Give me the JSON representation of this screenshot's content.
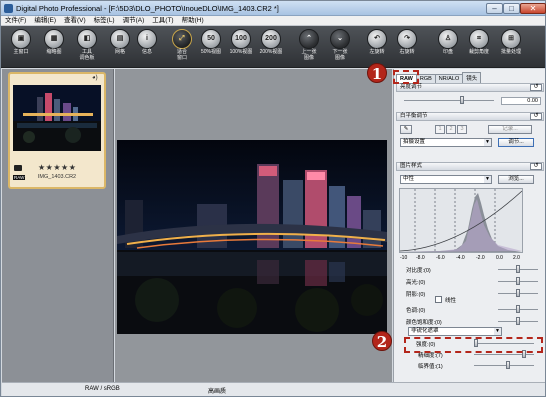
{
  "window": {
    "title": "Digital Photo Professional - [F:\\5D3\\DLO_PHOTO\\InoueDLO\\IMG_1403.CR2 *]"
  },
  "menu": [
    "文件(F)",
    "编辑(E)",
    "查看(V)",
    "标签(L)",
    "调节(A)",
    "工具(T)",
    "帮助(H)"
  ],
  "toolbar": [
    {
      "label": "主窗口",
      "icon": "main-window-icon"
    },
    {
      "label": "缩略图",
      "icon": "thumbnail-icon"
    },
    {
      "label": "工具\n调色板",
      "icon": "tool-palette-icon"
    },
    {
      "label": "网格",
      "icon": "grid-icon"
    },
    {
      "label": "信息",
      "icon": "info-icon"
    },
    {
      "label": "适合\n窗口",
      "icon": "fit-window-icon"
    },
    {
      "label": "50%视图",
      "icon": "zoom-50-icon",
      "text": "50"
    },
    {
      "label": "100%视图",
      "icon": "zoom-100-icon",
      "text": "100"
    },
    {
      "label": "200%视图",
      "icon": "zoom-200-icon",
      "text": "200"
    },
    {
      "label": "上一张\n图像",
      "icon": "prev-image-icon"
    },
    {
      "label": "下一张\n图像",
      "icon": "next-image-icon"
    },
    {
      "label": "左旋转",
      "icon": "rotate-left-icon"
    },
    {
      "label": "右旋转",
      "icon": "rotate-right-icon"
    },
    {
      "label": "印盘",
      "icon": "stamp-icon"
    },
    {
      "label": "裁剪角度",
      "icon": "crop-icon"
    },
    {
      "label": "批量处理",
      "icon": "batch-icon"
    }
  ],
  "thumbnail": {
    "filename": "IMG_1403.CR2",
    "rating": "★★★★★",
    "raw_badge": "RAW"
  },
  "tabs": [
    "RAW",
    "RGB",
    "NR/ALO",
    "镜头"
  ],
  "brightness": {
    "header": "亮度调节",
    "value": "0.00"
  },
  "white_balance": {
    "header": "白平衡调节",
    "nums": [
      "1",
      "2",
      "3"
    ],
    "record_btn": "记录...",
    "preset": "拍摄设置",
    "adjust_btn": "调节..."
  },
  "picture_style": {
    "header": "图片样式",
    "style": "中性",
    "browse_btn": "浏览..."
  },
  "hist_scale": [
    "-10",
    "-8.0",
    "-6.0",
    "-4.0",
    "-2.0",
    "0.0",
    "2.0"
  ],
  "adjust_rows": [
    {
      "label": "对比度:(0)"
    },
    {
      "label": "高光:(0)"
    },
    {
      "label": "阴影:(0)"
    },
    {
      "label": "色调:(0)"
    },
    {
      "label": "颜色饱和度:(0)"
    }
  ],
  "linear_label": "线性",
  "sharpen": {
    "mode": "非锐化遮罩",
    "strength": "强度:(0)",
    "fineness": "精细度:(7)",
    "threshold": "临界值:(1)"
  },
  "status": {
    "left": "RAW / sRGB",
    "center": "高画质"
  },
  "callouts": [
    "1",
    "2"
  ]
}
